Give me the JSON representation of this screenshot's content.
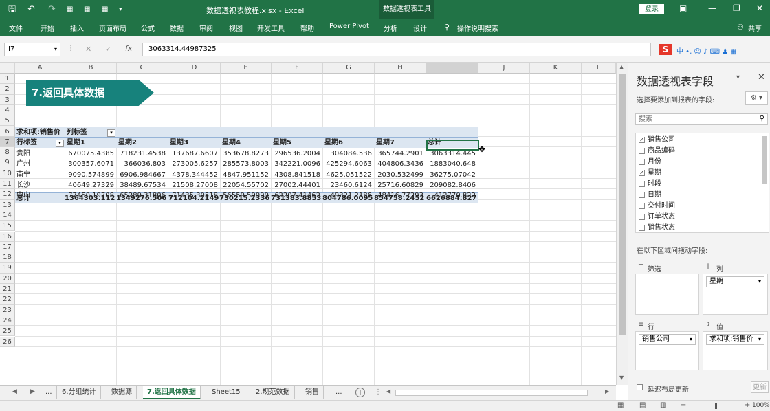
{
  "title_bar": {
    "file_title": "数据透视表教程.xlsx - Excel",
    "context_tab": "数据透视表工具",
    "login_button": "登录",
    "undo_icon": "undo-icon",
    "redo_icon": "redo-icon"
  },
  "ribbon": {
    "tabs": [
      "文件",
      "开始",
      "插入",
      "页面布局",
      "公式",
      "数据",
      "审阅",
      "视图",
      "开发工具",
      "帮助",
      "Power Pivot",
      "分析",
      "设计"
    ],
    "tell_me": "操作说明搜索",
    "share": "共享",
    "accent": "#217346"
  },
  "formula_bar": {
    "name_box": "I7",
    "formula": "3063314.44987325"
  },
  "columns": [
    "A",
    "B",
    "C",
    "D",
    "E",
    "F",
    "G",
    "H",
    "I",
    "J",
    "K",
    "L"
  ],
  "rows": [
    "1",
    "2",
    "3",
    "4",
    "5",
    "6",
    "7",
    "8",
    "9",
    "10",
    "11",
    "12",
    "13",
    "14",
    "15",
    "16",
    "17",
    "18",
    "19",
    "20",
    "21",
    "22",
    "23",
    "24",
    "25",
    "26"
  ],
  "banner": {
    "text": "7.返回具体数据",
    "color": "#17827c"
  },
  "pivot": {
    "value_label": "求和项:销售价",
    "col_label": "列标签",
    "row_label": "行标签",
    "headers": [
      "星期1",
      "星期2",
      "星期3",
      "星期4",
      "星期5",
      "星期6",
      "星期7",
      "总计"
    ],
    "rows": [
      {
        "name": "贵阳",
        "values": [
          "670075.4385",
          "718231.4538",
          "137687.6607",
          "353678.8273",
          "296536.2004",
          "304084.536",
          "365744.2901",
          "3063314.445"
        ]
      },
      {
        "name": "广州",
        "values": [
          "300357.6071",
          "366036.803",
          "273005.6257",
          "285573.8003",
          "342221.0096",
          "425294.6063",
          "404806.3436",
          "1883040.648"
        ]
      },
      {
        "name": "南宁",
        "values": [
          "9090.574899",
          "6906.984667",
          "4378.344452",
          "4847.951152",
          "4308.841518",
          "4625.051522",
          "2030.532499",
          "36275.07042"
        ]
      },
      {
        "name": "长沙",
        "values": [
          "40649.27329",
          "38489.67534",
          "21508.27008",
          "22054.55702",
          "27002.44401",
          "23460.6124",
          "25716.60829",
          "209082.8406"
        ]
      },
      {
        "name": "中山",
        "values": [
          "77450.19708",
          "65289.31806",
          "71435.30518",
          "56559.59999",
          "62207.41462",
          "49321.2186",
          "48416.77293",
          "412770.822"
        ]
      }
    ],
    "total": {
      "name": "总计",
      "values": [
        "1364303.112",
        "1349276.506",
        "712104.2149",
        "730215.2336",
        "731383.8853",
        "804786.0095",
        "854758.2452",
        "6626884.827"
      ]
    }
  },
  "sheet_tabs": [
    "...",
    "6.分组统计",
    "数据源",
    "7.返回具体数据",
    "Sheet15",
    "2.规范数据",
    "销售",
    "..."
  ],
  "active_sheet": "7.返回具体数据",
  "pane": {
    "title": "数据透视表字段",
    "subtitle": "选择要添加到报表的字段:",
    "search_placeholder": "搜索",
    "fields": [
      {
        "name": "销售公司",
        "checked": true
      },
      {
        "name": "商品编码",
        "checked": false
      },
      {
        "name": "月份",
        "checked": false
      },
      {
        "name": "星期",
        "checked": true
      },
      {
        "name": "时段",
        "checked": false
      },
      {
        "name": "日期",
        "checked": false
      },
      {
        "name": "交付时间",
        "checked": false
      },
      {
        "name": "订单状态",
        "checked": false
      },
      {
        "name": "销售状态",
        "checked": false
      }
    ],
    "drag_hint": "在以下区域间拖动字段:",
    "filters_label": "筛选",
    "columns_label": "列",
    "rows_label": "行",
    "values_label": "值",
    "columns_chip": "星期",
    "rows_chip": "销售公司",
    "values_chip": "求和项:销售价",
    "defer_label": "延迟布局更新",
    "update_button": "更新"
  },
  "status": {
    "zoom": "100%"
  }
}
